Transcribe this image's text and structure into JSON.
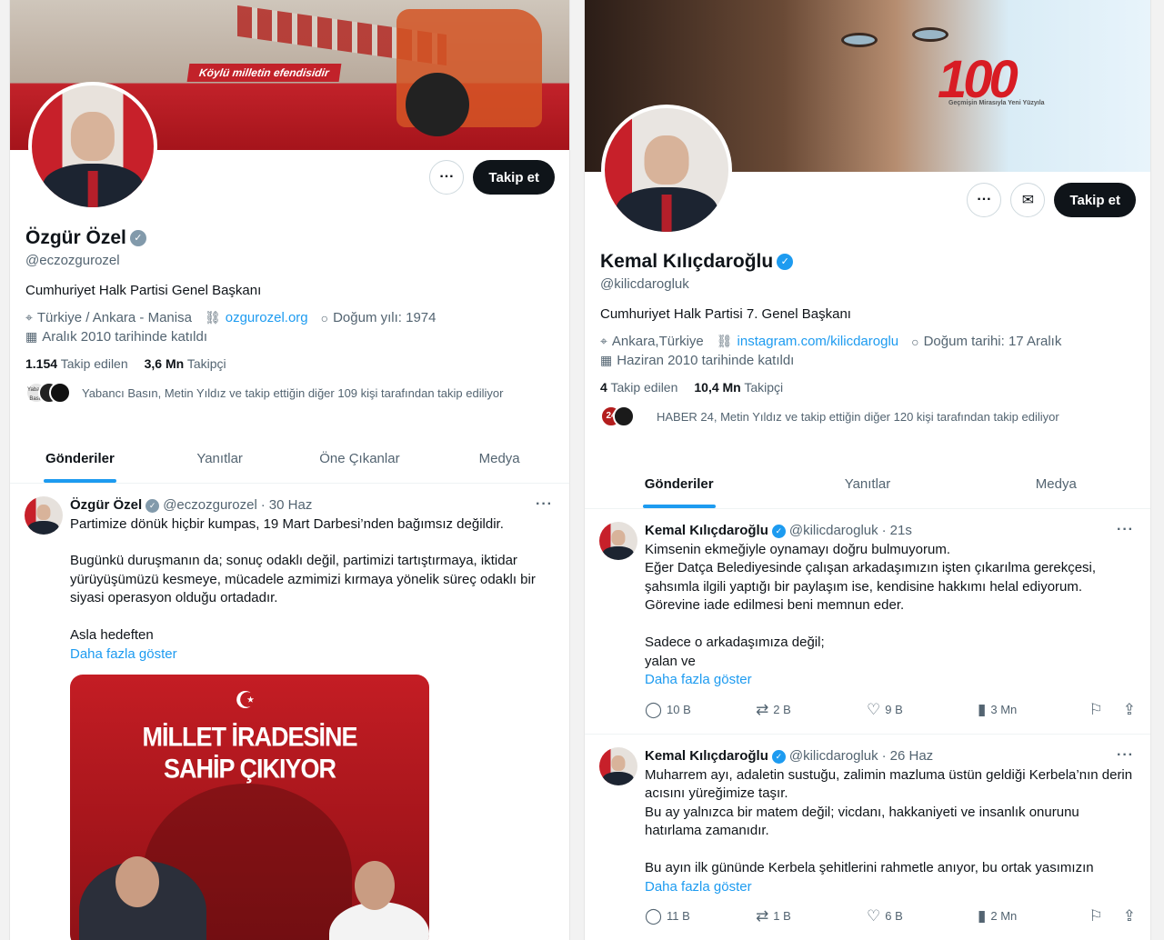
{
  "left": {
    "banner_slogan": "Köylü milletin efendisidir",
    "follow_label": "Takip et",
    "more_label": "···",
    "name": "Özgür Özel",
    "handle": "@eczozgurozel",
    "bio": "Cumhuriyet Halk Partisi Genel Başkanı",
    "location": "Türkiye / Ankara - Manisa",
    "website": "ozgurozel.org",
    "birth": "Doğum yılı: 1974",
    "joined": "Aralık 2010 tarihinde katıldı",
    "following_count": "1.154",
    "following_label": "Takip edilen",
    "followers_count": "3,6 Mn",
    "followers_label": "Takipçi",
    "followed_by": "Yabancı Basın, Metin Yıldız ve takip ettiğin diğer 109 kişi tarafından takip ediliyor",
    "followed_by_badge": "Yabancı Basın",
    "tabs": [
      "Gönderiler",
      "Yanıtlar",
      "Öne Çıkanlar",
      "Medya"
    ],
    "tweet": {
      "name": "Özgür Özel",
      "handle": "@eczozgurozel",
      "sep": "·",
      "date": "30 Haz",
      "lines": [
        "Partimize dönük hiçbir kumpas, 19 Mart Darbesi’nden bağımsız değildir.",
        "",
        "Bugünkü duruşmanın da; sonuç odaklı değil, partimizi tartıştırmaya, iktidar yürüyüşümüzü kesmeye, mücadele azmimizi kırmaya yönelik süreç odaklı bir siyasi operasyon olduğu ortadadır.",
        "",
        "Asla hedeften"
      ],
      "show_more": "Daha fazla göster",
      "image_title_1": "MİLLET İRADESİNE",
      "image_title_2": "SAHİP ÇIKIYOR"
    }
  },
  "right": {
    "banner_number": "100",
    "banner_sub": "Geçmişin Mirasıyla Yeni Yüzyıla",
    "follow_label": "Takip et",
    "more_label": "···",
    "name": "Kemal Kılıçdaroğlu",
    "handle": "@kilicdarogluk",
    "bio": "Cumhuriyet Halk Partisi 7. Genel Başkanı",
    "location": "Ankara,Türkiye",
    "website": "instagram.com/kilicdaroglu",
    "birth": "Doğum tarihi: 17 Aralık",
    "joined": "Haziran 2010 tarihinde katıldı",
    "following_count": "4",
    "following_label": "Takip edilen",
    "followers_count": "10,4 Mn",
    "followers_label": "Takipçi",
    "followed_by": "HABER 24, Metin Yıldız ve takip ettiğin diğer 120 kişi tarafından takip ediliyor",
    "followed_by_badge": "24",
    "tabs": [
      "Gönderiler",
      "Yanıtlar",
      "Medya"
    ],
    "tweets": [
      {
        "name": "Kemal Kılıçdaroğlu",
        "handle": "@kilicdarogluk",
        "sep": "·",
        "date": "21s",
        "lines": [
          "Kimsenin ekmeğiyle oynamayı doğru bulmuyorum.",
          "Eğer Datça Belediyesinde çalışan arkadaşımızın işten çıkarılma gerekçesi, şahsımla ilgili yaptığı bir paylaşım ise, kendisine hakkımı helal ediyorum. Görevine iade edilmesi beni memnun eder.",
          "",
          "Sadece o arkadaşımıza değil;",
          "yalan ve"
        ],
        "show_more": "Daha fazla göster",
        "replies": "10 B",
        "reposts": "2 B",
        "likes": "9 B",
        "views": "3 Mn"
      },
      {
        "name": "Kemal Kılıçdaroğlu",
        "handle": "@kilicdarogluk",
        "sep": "·",
        "date": "26 Haz",
        "lines": [
          "Muharrem ayı, adaletin sustuğu, zalimin mazluma üstün geldiği Kerbela’nın derin acısını yüreğimize taşır.",
          "Bu ay yalnızca bir matem değil; vicdanı, hakkaniyeti ve insanlık onurunu hatırlama zamanıdır.",
          "",
          "Bu ayın ilk gününde Kerbela şehitlerini rahmetle anıyor, bu ortak yasımızın"
        ],
        "show_more": "Daha fazla göster",
        "replies": "11 B",
        "reposts": "1 B",
        "likes": "6 B",
        "views": "2 Mn"
      }
    ]
  },
  "icons": {
    "location": "location-pin-icon",
    "link": "link-icon",
    "birthday": "balloon-icon",
    "calendar": "calendar-icon",
    "reply": "reply-icon",
    "repost": "repost-icon",
    "like": "heart-icon",
    "views": "views-icon",
    "bookmark": "bookmark-icon",
    "share": "share-icon",
    "message": "envelope-icon",
    "verified": "verified-badge-icon"
  },
  "colors": {
    "accent": "#1d9bf0",
    "text": "#0f1419",
    "muted": "#536471",
    "follow_button": "#0f1419",
    "party_red": "#c7202a"
  }
}
